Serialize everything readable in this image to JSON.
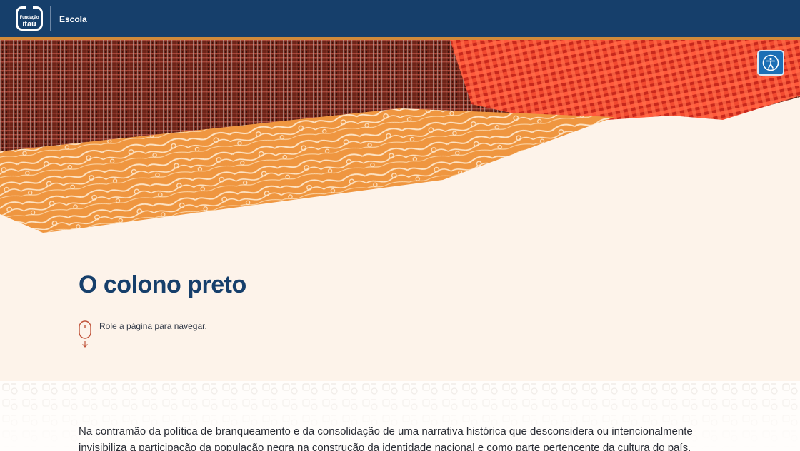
{
  "header": {
    "logo_line1": "Fundação",
    "logo_line2": "itaú",
    "brand": "Escola"
  },
  "colors": {
    "header_bg": "#163f6b",
    "accent_line": "#d18a3a",
    "page_bg": "#fdf3ea",
    "title": "#163f6b",
    "accessibility_button": "#1c6fb5"
  },
  "accessibility": {
    "icon": "accessibility-icon"
  },
  "main": {
    "title": "O colono preto",
    "scroll_hint": "Role a página para navegar.",
    "scroll_icon": "mouse-scroll-icon",
    "paragraph": "Na contramão da política de branqueamento e da consolidação de uma narrativa histórica que desconsidera ou intencionalmente invisibiliza a participação da população negra na construção da identidade nacional e como parte pertencente da cultura do país,"
  }
}
